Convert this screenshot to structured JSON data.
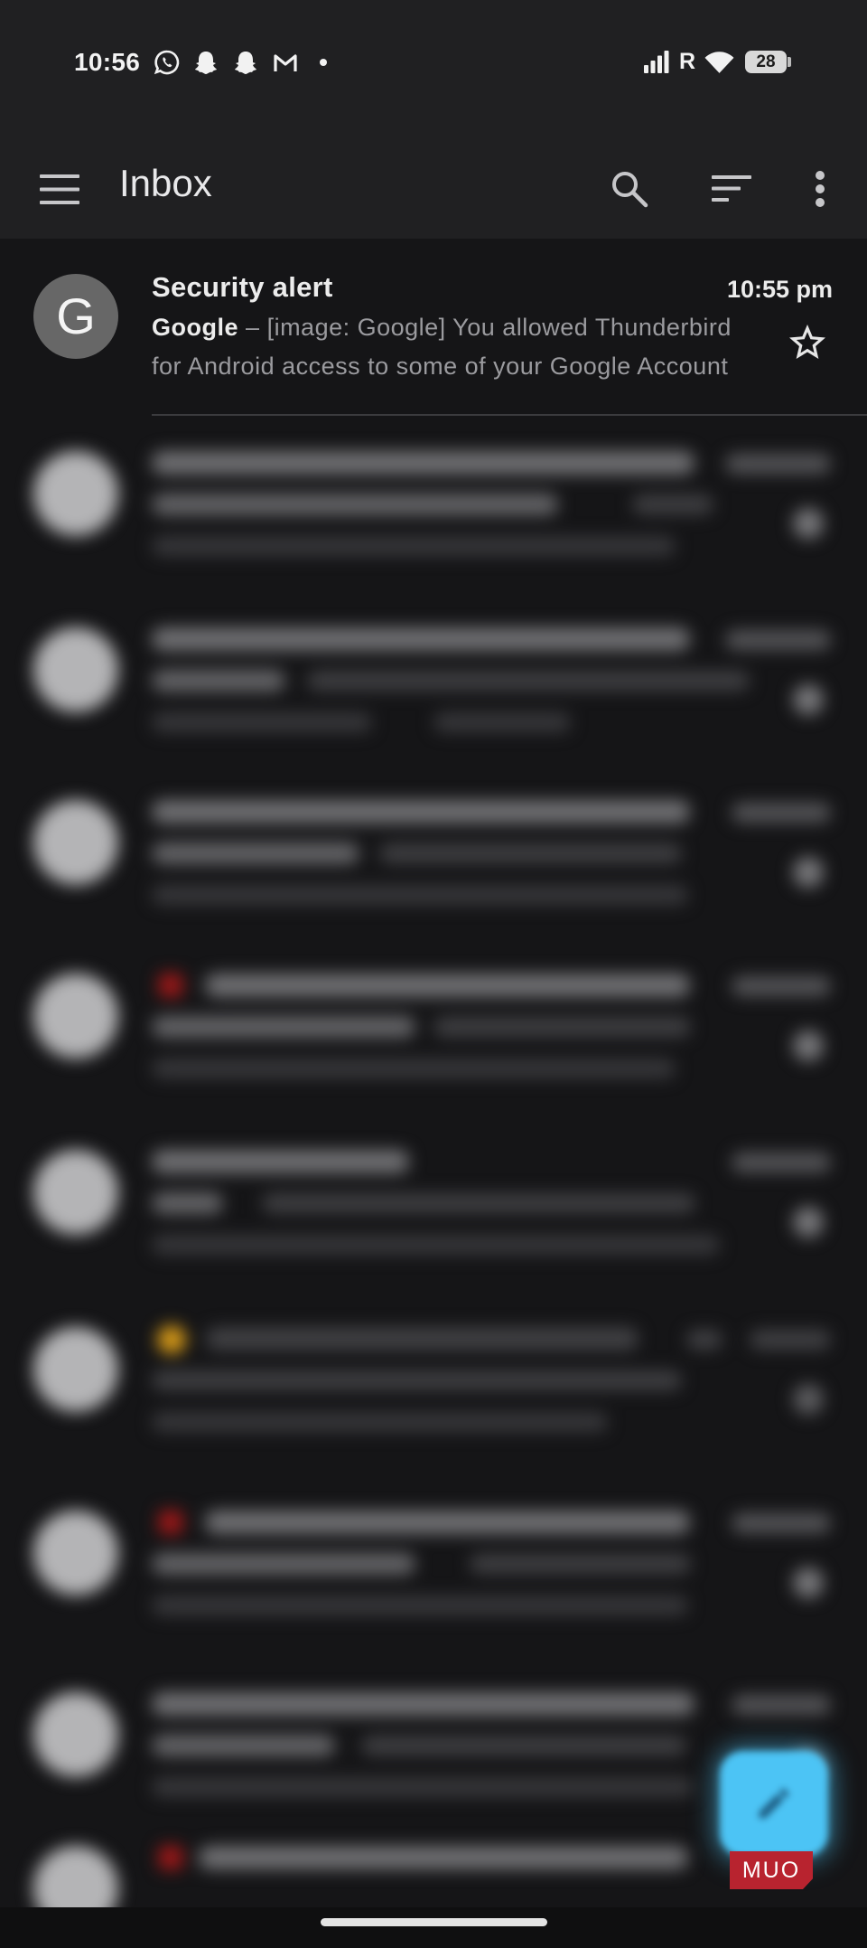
{
  "status_bar": {
    "time": "10:56",
    "notification_icons": [
      "whatsapp-icon",
      "snapchat-icon",
      "snapchat-icon",
      "gmail-icon",
      "notification-dot-icon"
    ],
    "signal_icon": "signal-bars-icon",
    "network_label": "R",
    "wifi_icon": "wifi-icon",
    "battery_level": "28"
  },
  "toolbar": {
    "title": "Inbox",
    "menu_icon": "menu-icon",
    "search_icon": "search-icon",
    "sort_icon": "sort-icon",
    "overflow_icon": "more-vert-icon"
  },
  "messages": [
    {
      "avatar_letter": "G",
      "subject": "Security alert",
      "time": "10:55 pm",
      "sender": "Google",
      "separator": "–",
      "snippet": "[image: Google] You allowed Thunderbird for Android access to some of your Google Account",
      "starred": false
    }
  ],
  "fab": {
    "icon": "pencil-icon"
  },
  "watermark": "MUO",
  "colors": {
    "header_bg": "#202022",
    "list_bg": "#151517",
    "avatar_bg": "#676767",
    "text_primary": "#ececec",
    "text_secondary": "#9b9b9f",
    "fab_accent": "#4cc4f5",
    "watermark_red": "#b8232f"
  }
}
